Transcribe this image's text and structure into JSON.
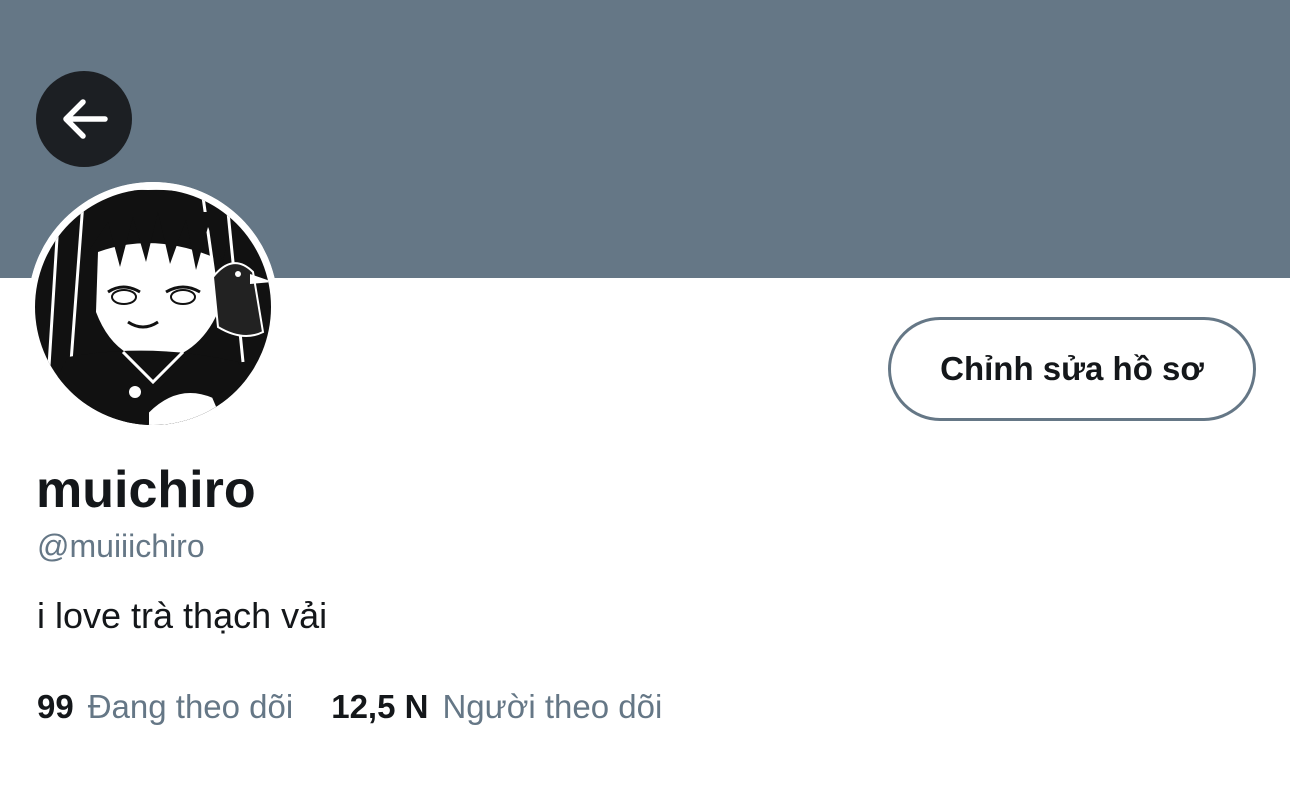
{
  "header": {
    "back_icon": "arrow-left-icon",
    "banner_color": "#657786"
  },
  "profile": {
    "display_name": "muichiro",
    "handle": "@muiiichiro",
    "bio": "i love trà thạch vải",
    "avatar_icon": "manga-avatar-image",
    "edit_button_label": "Chỉnh sửa hồ sơ"
  },
  "stats": {
    "following_count": "99",
    "following_label": "Đang theo dõi",
    "followers_count": "12,5 N",
    "followers_label": "Người theo dõi"
  },
  "colors": {
    "text_primary": "#14171a",
    "text_secondary": "#657786",
    "back_button_bg": "#1c1f23"
  }
}
